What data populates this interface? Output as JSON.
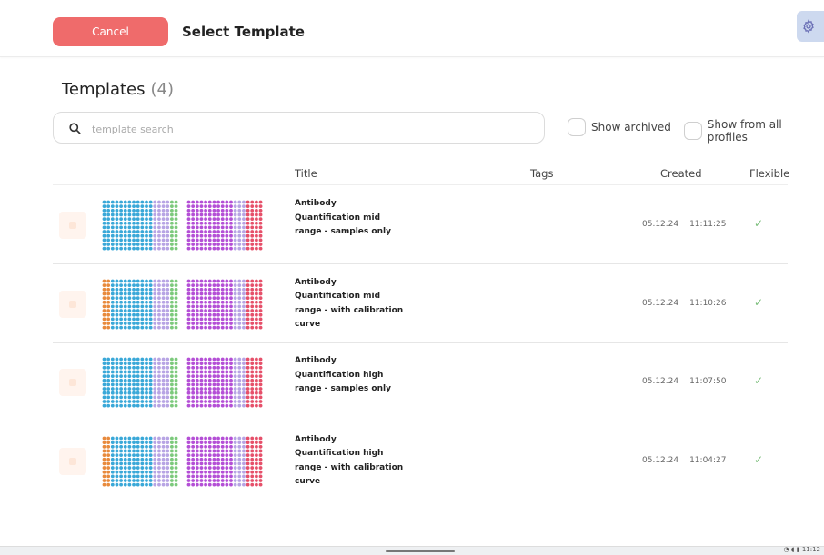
{
  "header": {
    "cancel_label": "Cancel",
    "title": "Select Template",
    "settings_icon": "gear-icon"
  },
  "templates": {
    "heading": "Templates",
    "count": "(4)"
  },
  "search": {
    "value": "",
    "placeholder": "template search"
  },
  "filters": {
    "show_archived": "Show archived",
    "show_all_profiles": "Show from all profiles"
  },
  "columns": {
    "title": "Title",
    "tags": "Tags",
    "created": "Created",
    "flexible": "Flexible"
  },
  "rows": [
    {
      "title": "Antibody Quantification mid range - samples only",
      "tags": "",
      "date": "05.12.24",
      "time": "11:11:25",
      "flexible": "✓",
      "calibration": false
    },
    {
      "title": "Antibody Quantification mid range - with calibration curve",
      "tags": "",
      "date": "05.12.24",
      "time": "11:10:26",
      "flexible": "✓",
      "calibration": true
    },
    {
      "title": "Antibody Quantification high range - samples only",
      "tags": "",
      "date": "05.12.24",
      "time": "11:07:50",
      "flexible": "✓",
      "calibration": false
    },
    {
      "title": "Antibody Quantification high range - with calibration curve",
      "tags": "",
      "date": "05.12.24",
      "time": "11:04:27",
      "flexible": "✓",
      "calibration": true
    }
  ],
  "plate_colors": {
    "blue": "#3aa8d8",
    "lavender": "#b7a4e4",
    "green": "#7cc97c",
    "purple": "#b44fd6",
    "red": "#e6506a",
    "orange": "#e88a3c"
  },
  "taskbar": {
    "clock": "11:12"
  }
}
